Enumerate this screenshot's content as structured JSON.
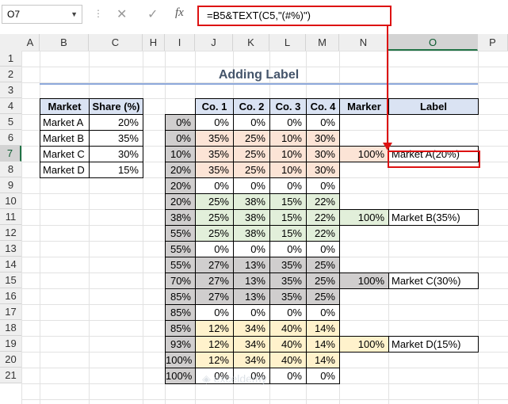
{
  "formula_bar": {
    "name_box": "O7",
    "formula": "=B5&TEXT(C5,\"(#%)\")",
    "cancel_glyph": "✕",
    "enter_glyph": "✓",
    "fx_glyph": "fx"
  },
  "columns": [
    "A",
    "B",
    "C",
    "H",
    "I",
    "J",
    "K",
    "L",
    "M",
    "N",
    "O",
    "P"
  ],
  "rows": [
    "1",
    "2",
    "3",
    "4",
    "5",
    "6",
    "7",
    "8",
    "9",
    "10",
    "11",
    "12",
    "13",
    "14",
    "15",
    "16",
    "17",
    "18",
    "19",
    "20",
    "21"
  ],
  "title": "Adding Label",
  "share_table": {
    "headers": [
      "Market",
      "Share (%)"
    ],
    "rows": [
      [
        "Market A",
        "20%"
      ],
      [
        "Market B",
        "35%"
      ],
      [
        "Market C",
        "30%"
      ],
      [
        "Market D",
        "15%"
      ]
    ]
  },
  "main_table": {
    "headers": [
      "Co. 1",
      "Co. 2",
      "Co. 3",
      "Co. 4",
      "Marker",
      "Label"
    ],
    "i_values": [
      "0%",
      "0%",
      "10%",
      "20%",
      "20%",
      "20%",
      "38%",
      "55%",
      "55%",
      "55%",
      "70%",
      "85%",
      "85%",
      "85%",
      "93%",
      "100%",
      "100%"
    ],
    "rows": [
      [
        "0%",
        "0%",
        "0%",
        "0%"
      ],
      [
        "35%",
        "25%",
        "10%",
        "30%"
      ],
      [
        "35%",
        "25%",
        "10%",
        "30%"
      ],
      [
        "35%",
        "25%",
        "10%",
        "30%"
      ],
      [
        "0%",
        "0%",
        "0%",
        "0%"
      ],
      [
        "25%",
        "38%",
        "15%",
        "22%"
      ],
      [
        "25%",
        "38%",
        "15%",
        "22%"
      ],
      [
        "25%",
        "38%",
        "15%",
        "22%"
      ],
      [
        "0%",
        "0%",
        "0%",
        "0%"
      ],
      [
        "27%",
        "13%",
        "35%",
        "25%"
      ],
      [
        "27%",
        "13%",
        "35%",
        "25%"
      ],
      [
        "27%",
        "13%",
        "35%",
        "25%"
      ],
      [
        "0%",
        "0%",
        "0%",
        "0%"
      ],
      [
        "12%",
        "34%",
        "40%",
        "14%"
      ],
      [
        "12%",
        "34%",
        "40%",
        "14%"
      ],
      [
        "12%",
        "34%",
        "40%",
        "14%"
      ],
      [
        "0%",
        "0%",
        "0%",
        "0%"
      ]
    ],
    "markers": {
      "7": "100%",
      "11": "100%",
      "15": "100%",
      "19": "100%"
    },
    "labels": {
      "7": "Market A(20%)",
      "11": "Market B(35%)",
      "15": "Market C(30%)",
      "19": "Market D(15%)"
    }
  },
  "colors": {
    "market_a": "#fce4d6",
    "market_b": "#e2efda",
    "market_c": "#d0cece",
    "market_d": "#fff2cc",
    "i_column": "#d0cece",
    "header": "#dae3f3",
    "highlight": "#dd1111"
  },
  "watermark": "exceldemy"
}
